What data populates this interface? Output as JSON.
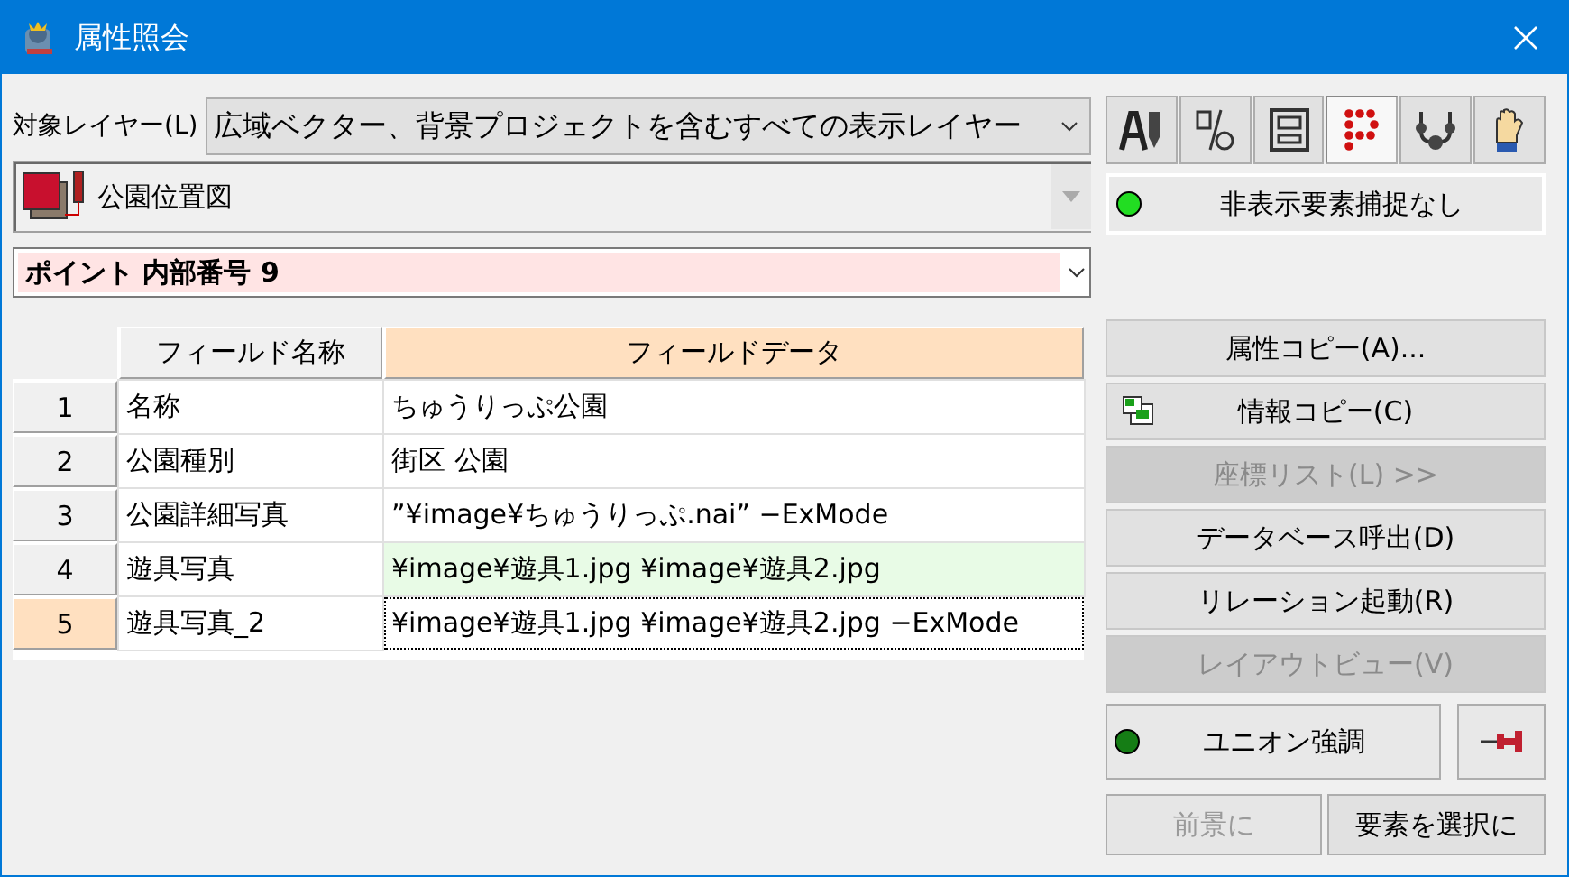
{
  "window": {
    "title": "属性照会"
  },
  "layer_label": "対象レイヤー(L)",
  "layer_select": {
    "value": "広域ベクター、背景プロジェクトを含むすべての表示レイヤー"
  },
  "layer_name": {
    "value": "公園位置図"
  },
  "element_select": {
    "value": "ポイント 内部番号 9"
  },
  "tools": [
    {
      "kind": "text",
      "selected": false
    },
    {
      "kind": "percent",
      "selected": false
    },
    {
      "kind": "frame",
      "selected": false
    },
    {
      "kind": "points",
      "selected": true
    },
    {
      "kind": "nodes",
      "selected": false
    },
    {
      "kind": "hand",
      "selected": false
    }
  ],
  "hidden_capture": {
    "label": "非表示要素捕捉なし",
    "on": true
  },
  "table": {
    "columns": [
      "フィールド名称",
      "フィールドデータ"
    ],
    "rows": [
      {
        "number": "1",
        "name": "名称",
        "data": "ちゅうりっぷ公園",
        "selected": false,
        "highlighted": false
      },
      {
        "number": "2",
        "name": "公園種別",
        "data": "街区 公園",
        "selected": false,
        "highlighted": false
      },
      {
        "number": "3",
        "name": "公園詳細写真",
        "data": "”¥image¥ちゅうりっぷ.nai” −ExMode",
        "selected": false,
        "highlighted": false
      },
      {
        "number": "4",
        "name": "遊具写真",
        "data": "¥image¥遊具1.jpg ¥image¥遊具2.jpg",
        "selected": false,
        "highlighted": true
      },
      {
        "number": "5",
        "name": "遊具写真_2",
        "data": "¥image¥遊具1.jpg ¥image¥遊具2.jpg −ExMode",
        "selected": true,
        "highlighted": false
      }
    ]
  },
  "actions": [
    {
      "kind": "plain",
      "label": "属性コピー(A)...",
      "disabled": false
    },
    {
      "kind": "copy",
      "label": "情報コピー(C)",
      "disabled": false
    },
    {
      "kind": "plain",
      "label": "座標リスト(L) >>",
      "disabled": true
    },
    {
      "kind": "plain",
      "label": "データベース呼出(D)",
      "disabled": false
    },
    {
      "kind": "plain",
      "label": "リレーション起動(R)",
      "disabled": false
    },
    {
      "kind": "plain",
      "label": "レイアウトビュー(V)",
      "disabled": true
    }
  ],
  "union": {
    "label": "ユニオン強調",
    "on": false
  },
  "bottom_buttons": [
    {
      "label": "前景に",
      "disabled": true
    },
    {
      "label": "要素を選択に",
      "disabled": false
    }
  ]
}
